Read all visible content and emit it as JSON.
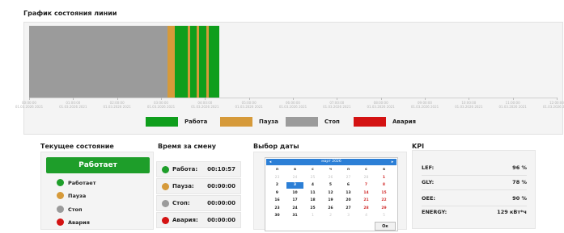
{
  "chart": {
    "title": "График состояния линии",
    "segments": [
      {
        "state": "stop",
        "start": 0.0,
        "end": 0.263
      },
      {
        "state": "pause",
        "start": 0.263,
        "end": 0.276
      },
      {
        "state": "work",
        "start": 0.276,
        "end": 0.3
      },
      {
        "state": "pause",
        "start": 0.3,
        "end": 0.305
      },
      {
        "state": "work",
        "start": 0.305,
        "end": 0.317
      },
      {
        "state": "pause",
        "start": 0.317,
        "end": 0.322
      },
      {
        "state": "work",
        "start": 0.322,
        "end": 0.336
      },
      {
        "state": "pause",
        "start": 0.336,
        "end": 0.34
      },
      {
        "state": "work",
        "start": 0.34,
        "end": 0.361
      }
    ],
    "ticks": [
      {
        "time": "00:00:00",
        "date": "01.03.2026 2021"
      },
      {
        "time": "01:00:00",
        "date": "01.03.2026 2021"
      },
      {
        "time": "02:00:00",
        "date": "01.03.2026 2021"
      },
      {
        "time": "03:00:00",
        "date": "01.03.2026 2021"
      },
      {
        "time": "04:00:00",
        "date": "01.03.2026 2021"
      },
      {
        "time": "05:00:00",
        "date": "01.03.2026 2021"
      },
      {
        "time": "06:00:00",
        "date": "01.03.2026 2021"
      },
      {
        "time": "07:00:00",
        "date": "01.03.2026 2021"
      },
      {
        "time": "08:00:00",
        "date": "01.03.2026 2021"
      },
      {
        "time": "09:00:00",
        "date": "01.03.2026 2021"
      },
      {
        "time": "10:00:00",
        "date": "01.03.2026 2021"
      },
      {
        "time": "11:00:00",
        "date": "01.03.2026 2021"
      },
      {
        "time": "12:00:00",
        "date": "01.03.2026 2021"
      }
    ],
    "legend": [
      {
        "label": "Работа",
        "color": "#0f9e1c"
      },
      {
        "label": "Пауза",
        "color": "#d69a3a"
      },
      {
        "label": "Стоп",
        "color": "#9b9b9b"
      },
      {
        "label": "Авария",
        "color": "#d41313"
      }
    ],
    "colors": {
      "work": "#0f9e1c",
      "pause": "#d69a3a",
      "stop": "#9b9b9b",
      "alarm": "#d41313"
    }
  },
  "current_state": {
    "title": "Текущее состояние",
    "value": "Работает",
    "items": [
      {
        "label": "Работает",
        "color": "#1e9e2a"
      },
      {
        "label": "Пауза",
        "color": "#d69a3a"
      },
      {
        "label": "Стоп",
        "color": "#9b9b9b"
      },
      {
        "label": "Авария",
        "color": "#d41313"
      }
    ]
  },
  "shift": {
    "title": "Время за смену",
    "rows": [
      {
        "label": "Работа:",
        "value": "00:10:57",
        "color": "#1e9e2a"
      },
      {
        "label": "Пауза:",
        "value": "00:00:00",
        "color": "#d69a3a"
      },
      {
        "label": "Стоп:",
        "value": "00:00:00",
        "color": "#9b9b9b"
      },
      {
        "label": "Авария:",
        "value": "00:00:00",
        "color": "#d41313"
      }
    ]
  },
  "date_picker": {
    "title": "Выбор даты",
    "month_label": "март 2026",
    "weekdays": [
      "п",
      "в",
      "с",
      "ч",
      "п",
      "с",
      "в"
    ],
    "weeks": [
      [
        "23",
        "24",
        "25",
        "26",
        "27",
        "28",
        "1"
      ],
      [
        "2",
        "3",
        "4",
        "5",
        "6",
        "7",
        "8"
      ],
      [
        "9",
        "10",
        "11",
        "12",
        "13",
        "14",
        "15"
      ],
      [
        "16",
        "17",
        "18",
        "19",
        "20",
        "21",
        "22"
      ],
      [
        "23",
        "24",
        "25",
        "26",
        "27",
        "28",
        "29"
      ],
      [
        "30",
        "31",
        "1",
        "2",
        "3",
        "4",
        "5"
      ]
    ],
    "ok_label": "Ок"
  },
  "kpi": {
    "title": "KPI",
    "rows": [
      {
        "label": "LEF:",
        "value": "96 %"
      },
      {
        "label": "GLY:",
        "value": "78 %"
      },
      {
        "label": "OEE:",
        "value": "90 %"
      },
      {
        "label": "ENERGY:",
        "value": "129 кВт*ч"
      }
    ]
  }
}
